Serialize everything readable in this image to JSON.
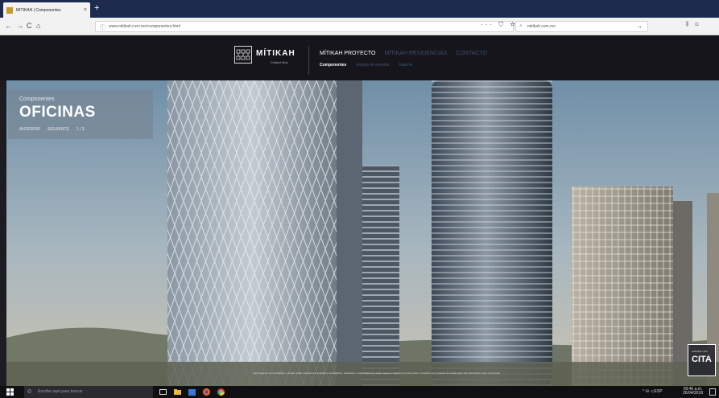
{
  "browser": {
    "tab_title": "MÍTIKAH | Componentes",
    "tab_close": "×",
    "new_tab": "+",
    "url": "www.mitikah.com.mx/componentes.html",
    "search_text": "mitikah.com.mx",
    "nav_back": "←",
    "nav_forward": "→",
    "nav_reload": "C",
    "nav_home": "⌂",
    "url_tools": "··· ⛉ ☆",
    "search_go": "→",
    "right_tools": "⫼ ⊡"
  },
  "site": {
    "logo_name": "MÍTIKAH",
    "logo_subtitle": "Ciudad Viva",
    "menu": [
      {
        "label": "MÍTIKAH PROYECTO",
        "active": true
      },
      {
        "label": "MÍTIKAH RESIDENCIAS",
        "active": false
      },
      {
        "label": "CONTACTO",
        "active": false
      }
    ],
    "submenu": [
      {
        "label": "Componentes",
        "active": true
      },
      {
        "label": "Espejo de eventos",
        "active": false
      },
      {
        "label": "Galería",
        "active": false
      }
    ]
  },
  "hero": {
    "eyebrow": "Componentes",
    "title": "OFICINAS",
    "prev_label": "ANTERIOR",
    "next_label": "SIGUIENTE",
    "counter": "1 / 3",
    "footer_note": "Las imágenes son ilustrativas y pueden variar respecto a la realidad. Los acabados, materiales y especificaciones están sujetos a cambios sin previo aviso. Consulte con un asesor de ventas para más información sobre el proyecto.",
    "cta_small": "AGENDA UNA",
    "cta_big": "CITA"
  },
  "taskbar": {
    "search_placeholder": "Escribe aquí para buscar",
    "tray": "^ ⛁ ◁ ESP",
    "time": "09:46 a.m.",
    "date": "26/04/2018"
  },
  "colors": {
    "site_header": "#15151b",
    "menu_dim": "#3e4e72",
    "panel": "#788492",
    "tabbar": "#1d2b4f"
  }
}
